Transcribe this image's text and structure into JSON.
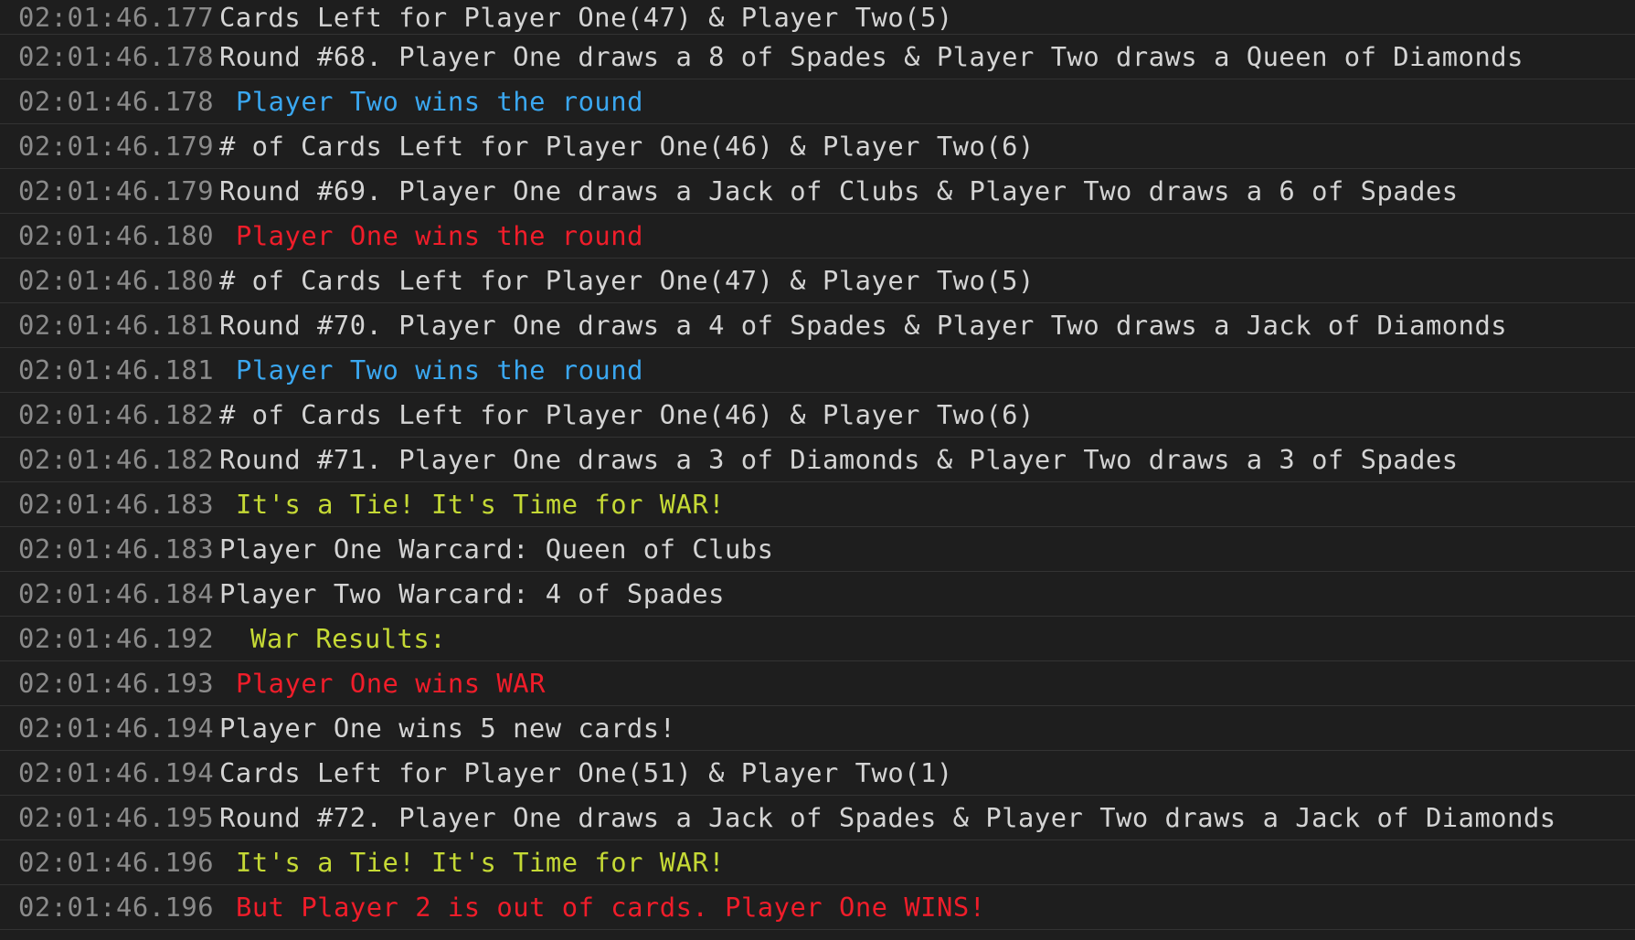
{
  "colors": {
    "background": "#1e1e1e",
    "timestamp": "#8b8b8b",
    "default_text": "#d4d4d4",
    "player_two": "#3aa7f0",
    "player_one": "#f01d2a",
    "tie": "#c5d935",
    "separator": "#333333"
  },
  "log": [
    {
      "time": "02:01:46.177",
      "text": "Cards Left for Player One(47) & Player Two(5)"
    },
    {
      "time": "02:01:46.178",
      "text": "Round #68. Player One draws a 8 of Spades & Player Two draws a Queen of Diamonds"
    },
    {
      "time": "02:01:46.178",
      "text": "Player Two wins the round"
    },
    {
      "time": "02:01:46.179",
      "text": "# of Cards Left for Player One(46) & Player Two(6)"
    },
    {
      "time": "02:01:46.179",
      "text": "Round #69. Player One draws a Jack of Clubs & Player Two draws a 6 of Spades"
    },
    {
      "time": "02:01:46.180",
      "text": "Player One wins the round"
    },
    {
      "time": "02:01:46.180",
      "text": "# of Cards Left for Player One(47) & Player Two(5)"
    },
    {
      "time": "02:01:46.181",
      "text": "Round #70. Player One draws a 4 of Spades & Player Two draws a Jack of Diamonds"
    },
    {
      "time": "02:01:46.181",
      "text": "Player Two wins the round"
    },
    {
      "time": "02:01:46.182",
      "text": "# of Cards Left for Player One(46) & Player Two(6)"
    },
    {
      "time": "02:01:46.182",
      "text": "Round #71. Player One draws a 3 of Diamonds & Player Two draws a 3 of Spades"
    },
    {
      "time": "02:01:46.183",
      "text": "It's a Tie! It's Time for WAR!"
    },
    {
      "time": "02:01:46.183",
      "text": "Player One Warcard: Queen of Clubs"
    },
    {
      "time": "02:01:46.184",
      "text": "Player Two Warcard: 4 of Spades"
    },
    {
      "time": "02:01:46.192",
      "text": "War Results:"
    },
    {
      "time": "02:01:46.193",
      "text": "Player One wins WAR"
    },
    {
      "time": "02:01:46.194",
      "text": "Player One wins 5 new cards!"
    },
    {
      "time": "02:01:46.194",
      "text": "Cards Left for Player One(51) & Player Two(1)"
    },
    {
      "time": "02:01:46.195",
      "text": "Round #72. Player One draws a Jack of Spades & Player Two draws a Jack of Diamonds"
    },
    {
      "time": "02:01:46.196",
      "text": "It's a Tie! It's Time for WAR!"
    },
    {
      "time": "02:01:46.196",
      "text": "But Player 2 is out of cards. Player One WINS!"
    }
  ]
}
